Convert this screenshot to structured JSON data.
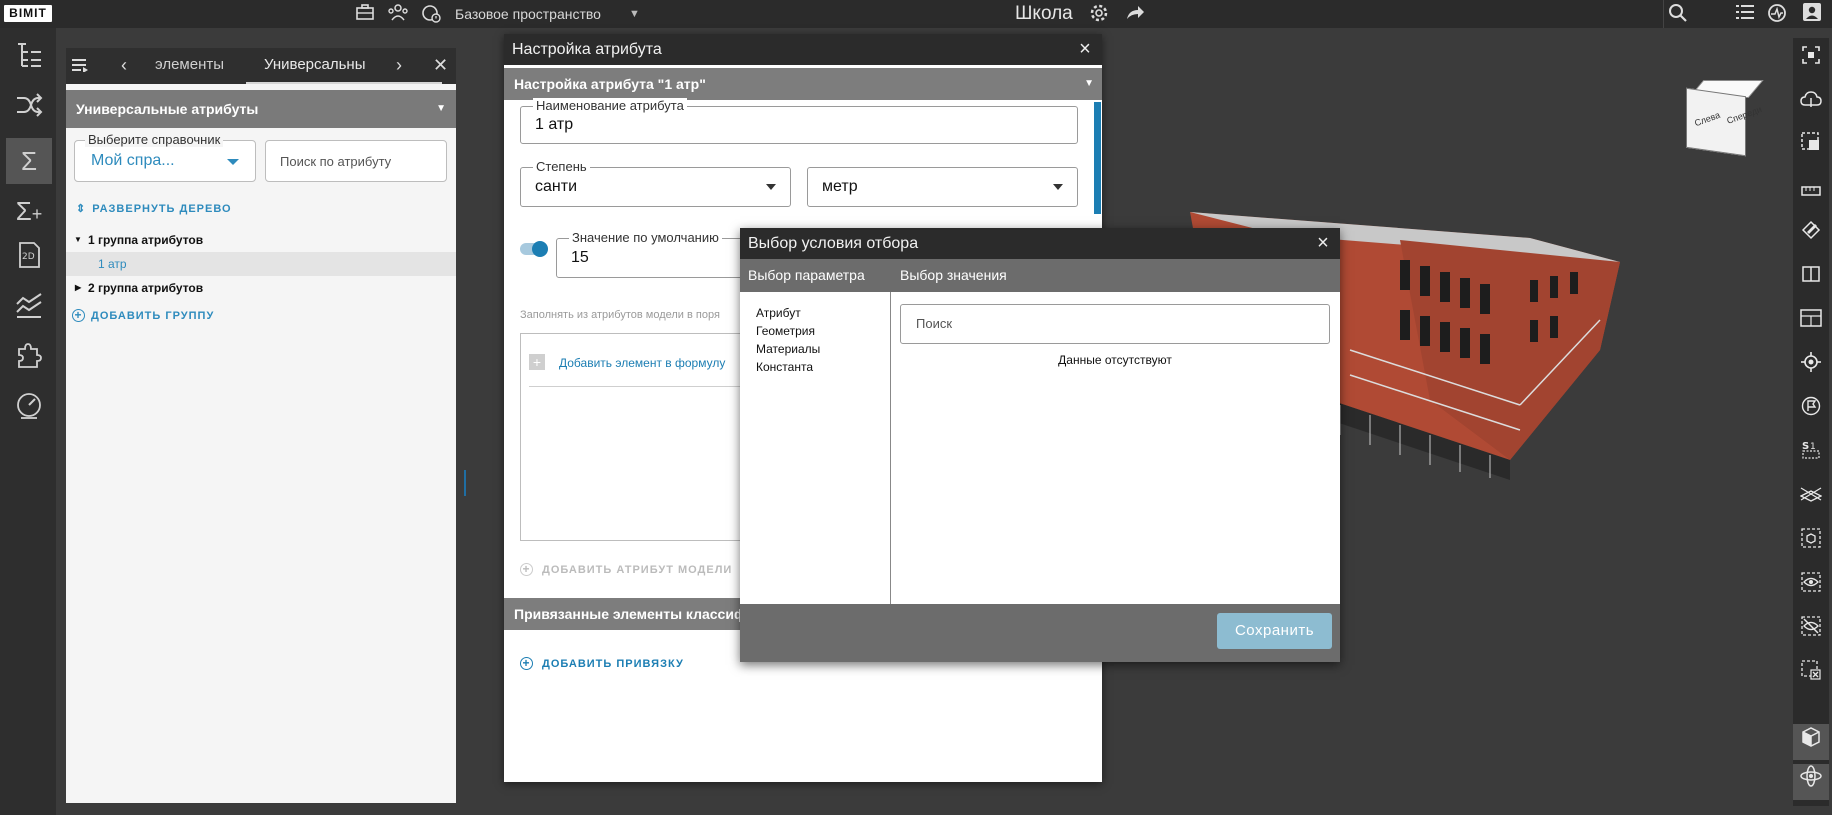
{
  "topbar": {
    "logo": "BIMIT",
    "space": "Базовое пространство",
    "project_title": "Школа",
    "icons": [
      "briefcase-icon",
      "team-icon",
      "clock-shield-icon",
      "gear-icon",
      "share-icon",
      "search-icon",
      "list-icon",
      "activity-icon",
      "user-icon"
    ]
  },
  "left_rail": {
    "tools": [
      "tree-icon",
      "shuffle-icon",
      "sigma-icon",
      "sigma-plus-icon",
      "2d-icon",
      "chart-icon",
      "puzzle-icon",
      "gauge-icon"
    ],
    "active": "sigma-icon",
    "help": "?"
  },
  "left_panel": {
    "tabs": [
      "элементы",
      "Универсальны"
    ],
    "active_tab": "Универсальны",
    "header": "Универсальные атрибуты",
    "dictionary": {
      "label": "Выберите справочник",
      "value": "Мой спра..."
    },
    "search": {
      "placeholder": "Поиск по атрибуту"
    },
    "expand_tree": "РАЗВЕРНУТЬ ДЕРЕВО",
    "tree": [
      {
        "label": "1 группа атрибутов",
        "expanded": true
      },
      {
        "label": "1 атр",
        "selected": true
      },
      {
        "label": "2 группа атрибутов",
        "expanded": false
      }
    ],
    "add_group": "ДОБАВИТЬ ГРУППУ"
  },
  "attr_dialog": {
    "title": "Настройка атрибута",
    "subtitle": "Настройка атрибута \"1 атр\"",
    "name_field": {
      "label": "Наименование атрибута",
      "value": "1 атр"
    },
    "degree_field": {
      "label": "Степень",
      "value": "санти"
    },
    "unit_field": {
      "value": "метр"
    },
    "default_field": {
      "label": "Значение по умолчанию",
      "value": "15"
    },
    "hint": "Заполнять из атрибутов модели в поря",
    "add_formula_element": "Добавить элемент в формулу",
    "add_model_attr": "ДОБАВИТЬ АТРИБУТ МОДЕЛИ",
    "bound_header": "Привязанные элементы классифи",
    "add_binding": "ДОБАВИТЬ ПРИВЯЗКУ"
  },
  "filter_dialog": {
    "title": "Выбор условия отбора",
    "col_param": "Выбор параметра",
    "col_value": "Выбор значения",
    "params": [
      "Атрибут",
      "Геометрия",
      "Материалы",
      "Константа"
    ],
    "search_placeholder": "Поиск",
    "empty_text": "Данные отсутствуют",
    "save": "Сохранить"
  },
  "right_rail": {
    "tools": [
      "focus-icon",
      "cloud-icon",
      "select-box-icon",
      "ruler-icon",
      "section-icon",
      "split-view-icon",
      "plan-icon",
      "locate-icon",
      "flag-icon",
      "stats-icon",
      "level-icon",
      "cube-outline-icon",
      "eye-icon",
      "eye-off-icon",
      "box-close-icon",
      "solid-cube-icon",
      "orbit-icon"
    ],
    "active": [
      "solid-cube-icon",
      "orbit-icon"
    ]
  },
  "viewport": {
    "cube_faces": [
      "Слева",
      "Спереди"
    ]
  }
}
